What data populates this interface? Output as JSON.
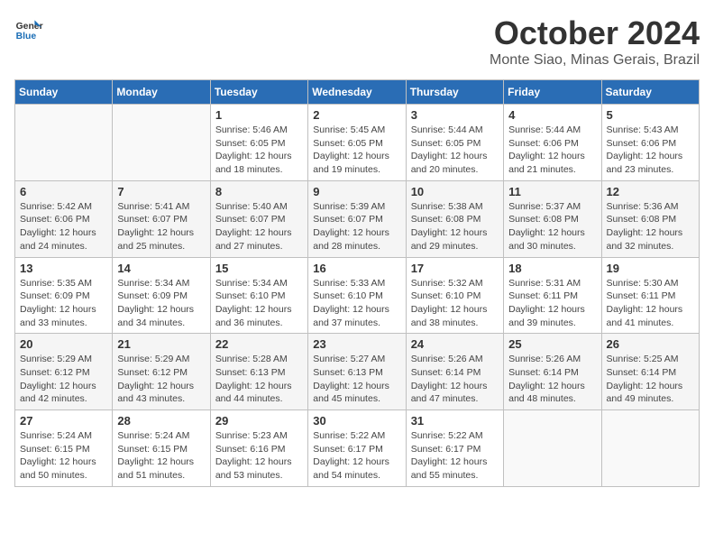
{
  "header": {
    "logo_line1": "General",
    "logo_line2": "Blue",
    "month": "October 2024",
    "location": "Monte Siao, Minas Gerais, Brazil"
  },
  "days_of_week": [
    "Sunday",
    "Monday",
    "Tuesday",
    "Wednesday",
    "Thursday",
    "Friday",
    "Saturday"
  ],
  "weeks": [
    [
      {
        "day": "",
        "content": ""
      },
      {
        "day": "",
        "content": ""
      },
      {
        "day": "1",
        "content": "Sunrise: 5:46 AM\nSunset: 6:05 PM\nDaylight: 12 hours and 18 minutes."
      },
      {
        "day": "2",
        "content": "Sunrise: 5:45 AM\nSunset: 6:05 PM\nDaylight: 12 hours and 19 minutes."
      },
      {
        "day": "3",
        "content": "Sunrise: 5:44 AM\nSunset: 6:05 PM\nDaylight: 12 hours and 20 minutes."
      },
      {
        "day": "4",
        "content": "Sunrise: 5:44 AM\nSunset: 6:06 PM\nDaylight: 12 hours and 21 minutes."
      },
      {
        "day": "5",
        "content": "Sunrise: 5:43 AM\nSunset: 6:06 PM\nDaylight: 12 hours and 23 minutes."
      }
    ],
    [
      {
        "day": "6",
        "content": "Sunrise: 5:42 AM\nSunset: 6:06 PM\nDaylight: 12 hours and 24 minutes."
      },
      {
        "day": "7",
        "content": "Sunrise: 5:41 AM\nSunset: 6:07 PM\nDaylight: 12 hours and 25 minutes."
      },
      {
        "day": "8",
        "content": "Sunrise: 5:40 AM\nSunset: 6:07 PM\nDaylight: 12 hours and 27 minutes."
      },
      {
        "day": "9",
        "content": "Sunrise: 5:39 AM\nSunset: 6:07 PM\nDaylight: 12 hours and 28 minutes."
      },
      {
        "day": "10",
        "content": "Sunrise: 5:38 AM\nSunset: 6:08 PM\nDaylight: 12 hours and 29 minutes."
      },
      {
        "day": "11",
        "content": "Sunrise: 5:37 AM\nSunset: 6:08 PM\nDaylight: 12 hours and 30 minutes."
      },
      {
        "day": "12",
        "content": "Sunrise: 5:36 AM\nSunset: 6:08 PM\nDaylight: 12 hours and 32 minutes."
      }
    ],
    [
      {
        "day": "13",
        "content": "Sunrise: 5:35 AM\nSunset: 6:09 PM\nDaylight: 12 hours and 33 minutes."
      },
      {
        "day": "14",
        "content": "Sunrise: 5:34 AM\nSunset: 6:09 PM\nDaylight: 12 hours and 34 minutes."
      },
      {
        "day": "15",
        "content": "Sunrise: 5:34 AM\nSunset: 6:10 PM\nDaylight: 12 hours and 36 minutes."
      },
      {
        "day": "16",
        "content": "Sunrise: 5:33 AM\nSunset: 6:10 PM\nDaylight: 12 hours and 37 minutes."
      },
      {
        "day": "17",
        "content": "Sunrise: 5:32 AM\nSunset: 6:10 PM\nDaylight: 12 hours and 38 minutes."
      },
      {
        "day": "18",
        "content": "Sunrise: 5:31 AM\nSunset: 6:11 PM\nDaylight: 12 hours and 39 minutes."
      },
      {
        "day": "19",
        "content": "Sunrise: 5:30 AM\nSunset: 6:11 PM\nDaylight: 12 hours and 41 minutes."
      }
    ],
    [
      {
        "day": "20",
        "content": "Sunrise: 5:29 AM\nSunset: 6:12 PM\nDaylight: 12 hours and 42 minutes."
      },
      {
        "day": "21",
        "content": "Sunrise: 5:29 AM\nSunset: 6:12 PM\nDaylight: 12 hours and 43 minutes."
      },
      {
        "day": "22",
        "content": "Sunrise: 5:28 AM\nSunset: 6:13 PM\nDaylight: 12 hours and 44 minutes."
      },
      {
        "day": "23",
        "content": "Sunrise: 5:27 AM\nSunset: 6:13 PM\nDaylight: 12 hours and 45 minutes."
      },
      {
        "day": "24",
        "content": "Sunrise: 5:26 AM\nSunset: 6:14 PM\nDaylight: 12 hours and 47 minutes."
      },
      {
        "day": "25",
        "content": "Sunrise: 5:26 AM\nSunset: 6:14 PM\nDaylight: 12 hours and 48 minutes."
      },
      {
        "day": "26",
        "content": "Sunrise: 5:25 AM\nSunset: 6:14 PM\nDaylight: 12 hours and 49 minutes."
      }
    ],
    [
      {
        "day": "27",
        "content": "Sunrise: 5:24 AM\nSunset: 6:15 PM\nDaylight: 12 hours and 50 minutes."
      },
      {
        "day": "28",
        "content": "Sunrise: 5:24 AM\nSunset: 6:15 PM\nDaylight: 12 hours and 51 minutes."
      },
      {
        "day": "29",
        "content": "Sunrise: 5:23 AM\nSunset: 6:16 PM\nDaylight: 12 hours and 53 minutes."
      },
      {
        "day": "30",
        "content": "Sunrise: 5:22 AM\nSunset: 6:17 PM\nDaylight: 12 hours and 54 minutes."
      },
      {
        "day": "31",
        "content": "Sunrise: 5:22 AM\nSunset: 6:17 PM\nDaylight: 12 hours and 55 minutes."
      },
      {
        "day": "",
        "content": ""
      },
      {
        "day": "",
        "content": ""
      }
    ]
  ]
}
